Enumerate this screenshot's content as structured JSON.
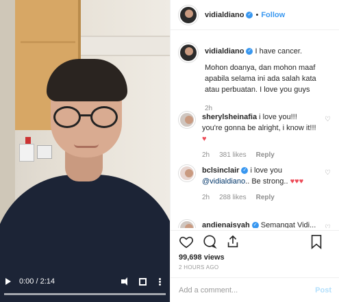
{
  "colors": {
    "accent": "#3897f0",
    "text": "#262626",
    "muted": "#8e8e8e",
    "heart": "#ed4956",
    "post_disabled": "#b2dffc"
  },
  "video": {
    "current_time": "0:00 / 2:14",
    "progress_fraction": 0.0,
    "icons": [
      "play-icon",
      "volume-icon",
      "fullscreen-icon",
      "more-icon"
    ]
  },
  "header": {
    "username": "vidialdiano",
    "separator": "•",
    "follow_label": "Follow"
  },
  "caption": {
    "username": "vidialdiano",
    "text_line1": "I have cancer.",
    "text_line2": "Mohon doanya, dan mohon maaf apabila selama ini ada salah kata atau perbuatan. I love you guys",
    "time": "2h"
  },
  "comments": [
    {
      "username": "sherylsheinafia",
      "text": "i love you!!! you're gonna be alright, i know it!!!",
      "time": "2h",
      "likes": "381 likes",
      "reply_label": "Reply"
    },
    {
      "username": "bclsinclair",
      "text_pre": "i love you",
      "mention": "@vidialdiano",
      "text_post": ".. Be strong..",
      "time": "2h",
      "likes": "288 likes",
      "reply_label": "Reply"
    },
    {
      "username": "andienaisyah",
      "text": "Semangat Vidi..."
    }
  ],
  "stats": {
    "views": "99,698 views",
    "ago": "2 HOURS AGO"
  },
  "add_comment": {
    "placeholder": "Add a comment...",
    "post_label": "Post"
  }
}
